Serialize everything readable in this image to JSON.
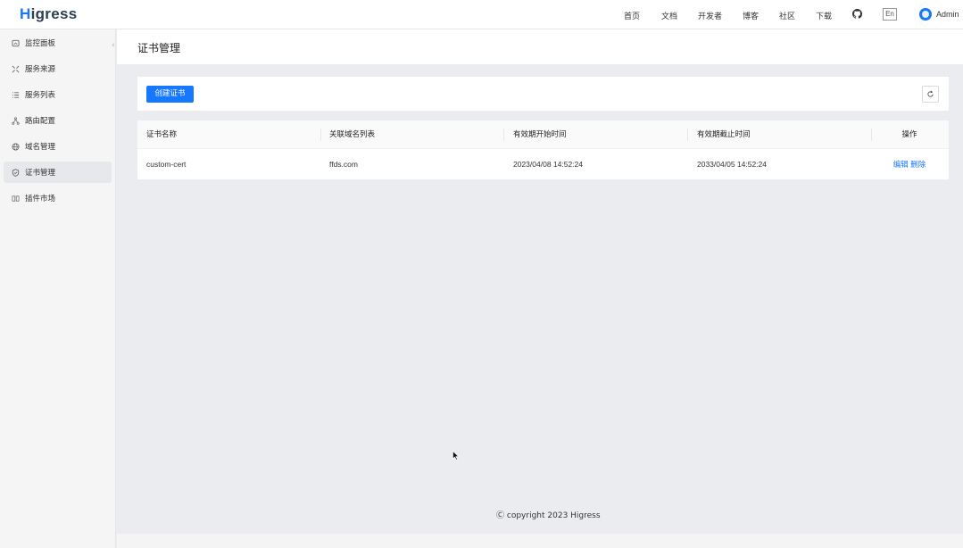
{
  "app": {
    "logo_h": "H",
    "logo_rest": "igress"
  },
  "topnav": {
    "home": "首页",
    "docs": "文档",
    "developer": "开发者",
    "blog": "博客",
    "community": "社区",
    "download": "下载",
    "lang": "En",
    "user": "Admin"
  },
  "sidebar": {
    "items": [
      {
        "label": "监控面板",
        "icon": "dashboard-icon"
      },
      {
        "label": "服务来源",
        "icon": "service-source-icon"
      },
      {
        "label": "服务列表",
        "icon": "list-icon"
      },
      {
        "label": "路由配置",
        "icon": "route-icon"
      },
      {
        "label": "域名管理",
        "icon": "globe-icon"
      },
      {
        "label": "证书管理",
        "icon": "shield-icon",
        "active": true
      },
      {
        "label": "插件市场",
        "icon": "plugin-icon"
      }
    ]
  },
  "page": {
    "title": "证书管理"
  },
  "toolbar": {
    "create_label": "创建证书"
  },
  "table": {
    "headers": [
      "证书名称",
      "关联域名列表",
      "有效期开始时间",
      "有效期截止时间",
      "操作"
    ],
    "rows": [
      {
        "name": "custom-cert",
        "domains": "ffds.com",
        "start": "2023/04/08 14:52:24",
        "end": "2033/04/05 14:52:24",
        "edit": "编辑",
        "delete": "删除"
      }
    ]
  },
  "footer": {
    "text": "copyright 2023 Higress"
  },
  "colors": {
    "accent": "#1677ff",
    "background": "#ebecef"
  }
}
